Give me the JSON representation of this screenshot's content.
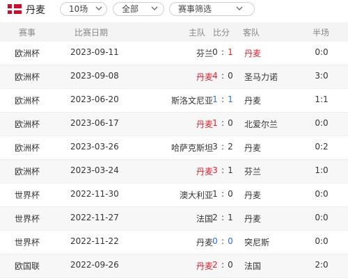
{
  "header": {
    "team": "丹麦",
    "count_filter": "10场",
    "type_filter": "全部",
    "event_filter": "赛事筛选"
  },
  "columns": {
    "event": "赛事",
    "date": "比赛日期",
    "home": "主队",
    "score": "比分",
    "away": "客队",
    "half": "半场"
  },
  "matches": [
    {
      "event": "欧洲杯",
      "date": "2023-09-11",
      "home": "芬兰",
      "hs": "0",
      "as": "1",
      "away": "丹麦",
      "half": "0:0",
      "home_red": false,
      "away_red": true,
      "hs_color": "normal",
      "as_color": "red"
    },
    {
      "event": "欧洲杯",
      "date": "2023-09-08",
      "home": "丹麦",
      "hs": "4",
      "as": "0",
      "away": "圣马力诺",
      "half": "3:0",
      "home_red": true,
      "away_red": false,
      "hs_color": "red",
      "as_color": "normal"
    },
    {
      "event": "欧洲杯",
      "date": "2023-06-20",
      "home": "斯洛文尼亚",
      "hs": "1",
      "as": "1",
      "away": "丹麦",
      "half": "1:1",
      "home_red": false,
      "away_red": false,
      "hs_color": "blue",
      "as_color": "blue"
    },
    {
      "event": "欧洲杯",
      "date": "2023-06-17",
      "home": "丹麦",
      "hs": "1",
      "as": "0",
      "away": "北爱尔兰",
      "half": "0:0",
      "home_red": true,
      "away_red": false,
      "hs_color": "red",
      "as_color": "normal"
    },
    {
      "event": "欧洲杯",
      "date": "2023-03-26",
      "home": "哈萨克斯坦",
      "hs": "3",
      "as": "2",
      "away": "丹麦",
      "half": "0:2",
      "home_red": false,
      "away_red": false,
      "hs_color": "normal",
      "as_color": "normal"
    },
    {
      "event": "欧洲杯",
      "date": "2023-03-24",
      "home": "丹麦",
      "hs": "3",
      "as": "1",
      "away": "芬兰",
      "half": "1:0",
      "home_red": true,
      "away_red": false,
      "hs_color": "red",
      "as_color": "normal"
    },
    {
      "event": "世界杯",
      "date": "2022-11-30",
      "home": "澳大利亚",
      "hs": "1",
      "as": "0",
      "away": "丹麦",
      "half": "0:0",
      "home_red": false,
      "away_red": false,
      "hs_color": "normal",
      "as_color": "normal"
    },
    {
      "event": "世界杯",
      "date": "2022-11-27",
      "home": "法国",
      "hs": "2",
      "as": "1",
      "away": "丹麦",
      "half": "0:0",
      "home_red": false,
      "away_red": false,
      "hs_color": "normal",
      "as_color": "normal"
    },
    {
      "event": "世界杯",
      "date": "2022-11-22",
      "home": "丹麦",
      "hs": "0",
      "as": "0",
      "away": "突尼斯",
      "half": "0:0",
      "home_red": false,
      "away_red": false,
      "hs_color": "blue",
      "as_color": "blue"
    },
    {
      "event": "欧国联",
      "date": "2022-09-26",
      "home": "丹麦",
      "hs": "2",
      "as": "0",
      "away": "法国",
      "half": "2:0",
      "home_red": true,
      "away_red": false,
      "hs_color": "red",
      "as_color": "normal"
    }
  ],
  "colors": {
    "win_red": "#d9232e",
    "draw_blue": "#2b6de0",
    "flag_red": "#c8102e"
  }
}
